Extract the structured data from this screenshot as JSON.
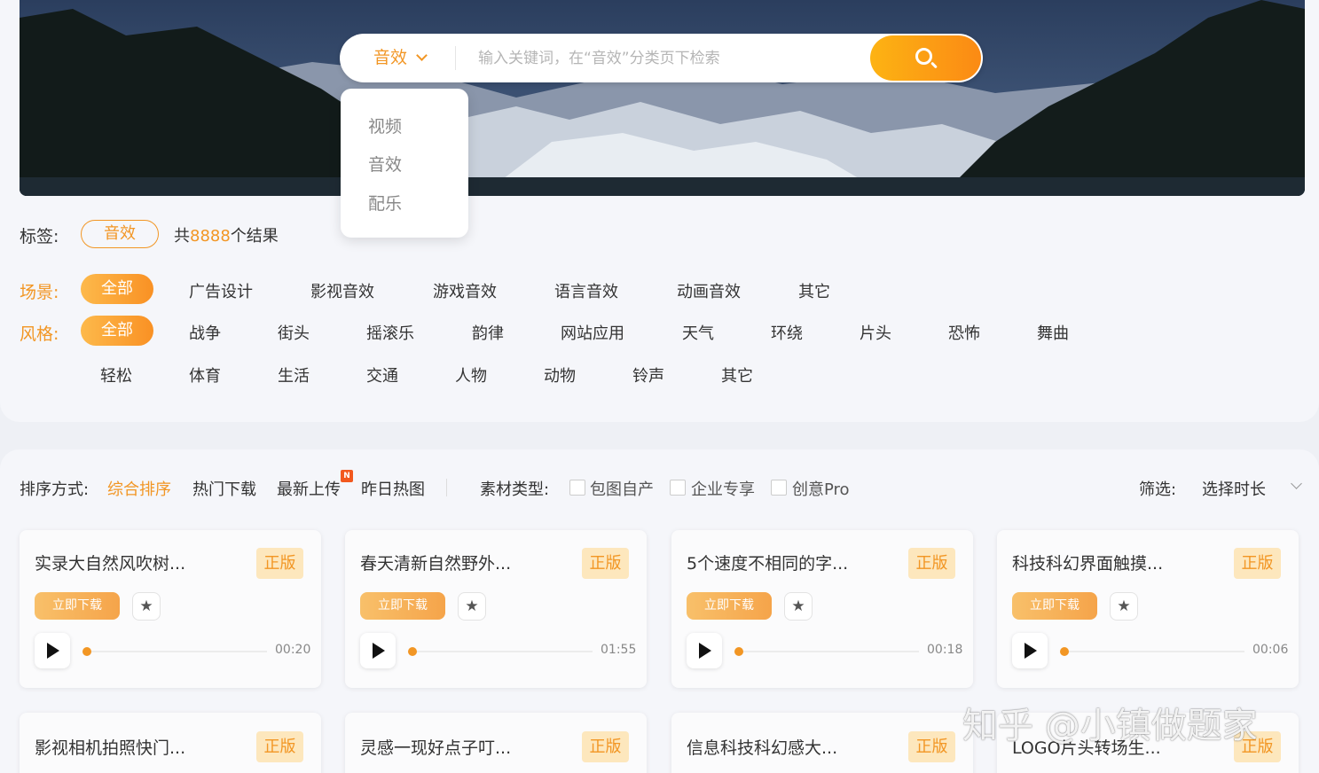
{
  "search": {
    "category": "音效",
    "placeholder": "输入关键词，在“音效”分类页下检索",
    "dropdown_options": [
      "视频",
      "音效",
      "配乐"
    ]
  },
  "tag_row": {
    "label": "标签:",
    "active_tag": "音效",
    "count_prefix": "共",
    "count": "8888",
    "count_suffix": "个结果"
  },
  "scene": {
    "label": "场景:",
    "active": "全部",
    "options": [
      "广告设计",
      "影视音效",
      "游戏音效",
      "语言音效",
      "动画音效",
      "其它"
    ]
  },
  "style": {
    "label": "风格:",
    "active": "全部",
    "row1": [
      "战争",
      "街头",
      "摇滚乐",
      "韵律",
      "网站应用",
      "天气",
      "环绕",
      "片头",
      "恐怖",
      "舞曲"
    ],
    "row2": [
      "轻松",
      "体育",
      "生活",
      "交通",
      "人物",
      "动物",
      "铃声",
      "其它"
    ]
  },
  "sort": {
    "label": "排序方式:",
    "options": [
      "综合排序",
      "热门下载",
      "最新上传",
      "昨日热图"
    ],
    "new_badge": "N",
    "material_label": "素材类型:",
    "checkboxes": [
      "包图自产",
      "企业专享",
      "创意Pro"
    ],
    "filter_label": "筛选:",
    "duration_select": "选择时长"
  },
  "cards": [
    {
      "title": "实录大自然风吹树...",
      "badge": "正版",
      "download": "立即下载",
      "duration": "00:20"
    },
    {
      "title": "春天清新自然野外...",
      "badge": "正版",
      "download": "立即下载",
      "duration": "01:55"
    },
    {
      "title": "5个速度不相同的字...",
      "badge": "正版",
      "download": "立即下载",
      "duration": "00:18"
    },
    {
      "title": "科技科幻界面触摸...",
      "badge": "正版",
      "download": "立即下载",
      "duration": "00:06"
    }
  ],
  "cards_row2": [
    {
      "title": "影视相机拍照快门...",
      "badge": "正版"
    },
    {
      "title": "灵感一现好点子叮...",
      "badge": "正版"
    },
    {
      "title": "信息科技科幻感大...",
      "badge": "正版"
    },
    {
      "title": "LOGO片头转场生...",
      "badge": "正版"
    }
  ],
  "watermark": "知乎 @小镇做题家",
  "colors": {
    "accent": "#f29624",
    "button_gradient_start": "#fdb313",
    "button_gradient_end": "#fb8a14",
    "badge_bg": "#fde7bd"
  },
  "icons": {
    "search": "search-icon",
    "chevron": "chevron-down-icon",
    "star": "star-icon",
    "play": "play-icon"
  }
}
